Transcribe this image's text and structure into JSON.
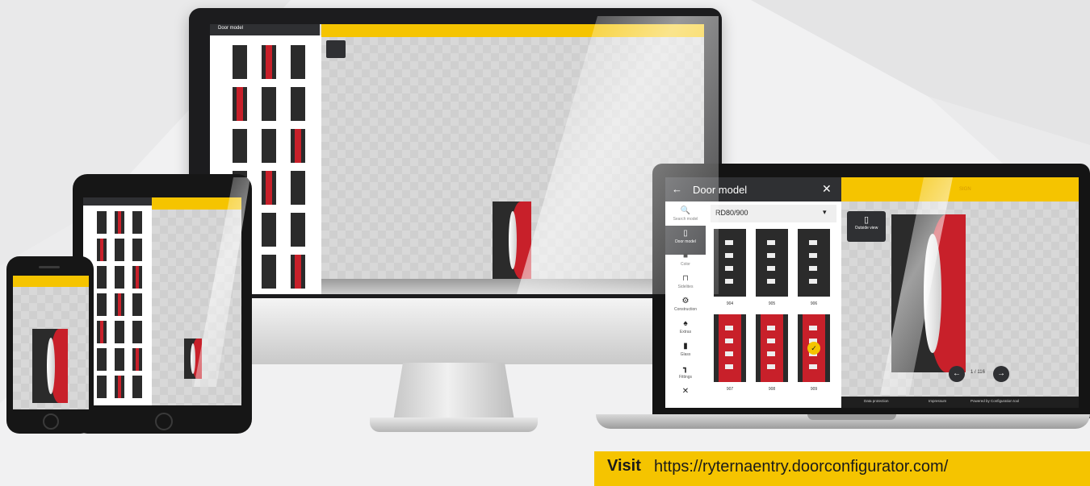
{
  "app": {
    "panel_title": "Door model",
    "back_glyph": "←",
    "close_glyph": "✕",
    "model_group": "RD80/900",
    "dropdown_arrow": "▾",
    "nav": [
      {
        "label": "Search model",
        "icon": "search-icon",
        "glyph": "🔍"
      },
      {
        "label": "Door model",
        "icon": "door-icon",
        "glyph": "▯"
      },
      {
        "label": "Color",
        "icon": "color-square-icon",
        "glyph": "■"
      },
      {
        "label": "Sidelites",
        "icon": "sidelites-icon",
        "glyph": "⊓"
      },
      {
        "label": "Construction",
        "icon": "gear-icon",
        "glyph": "⚙"
      },
      {
        "label": "Extras",
        "icon": "bell-icon",
        "glyph": "♠"
      },
      {
        "label": "Glass",
        "icon": "glass-icon",
        "glyph": "▮"
      },
      {
        "label": "Fittings",
        "icon": "handle-icon",
        "glyph": "┓"
      },
      {
        "label": "",
        "icon": "tools-icon",
        "glyph": "✕"
      }
    ],
    "models": [
      {
        "code": "904"
      },
      {
        "code": "905"
      },
      {
        "code": "906"
      },
      {
        "code": "907"
      },
      {
        "code": "908"
      },
      {
        "code": "909"
      }
    ],
    "outside_view": "Outside view",
    "top_right_text": "SIGN",
    "pager": {
      "prev": "←",
      "next": "→",
      "text": "1 / 116"
    },
    "footer": [
      "Data protection",
      "Impressum",
      "Powered by Configuration tool"
    ]
  },
  "banner": {
    "strong": "Visit",
    "url": "https://ryternaentry.doorconfigurator.com/"
  },
  "colors": {
    "accent": "#f5c400",
    "dark": "#2f3033",
    "door_red": "#c8202a"
  }
}
